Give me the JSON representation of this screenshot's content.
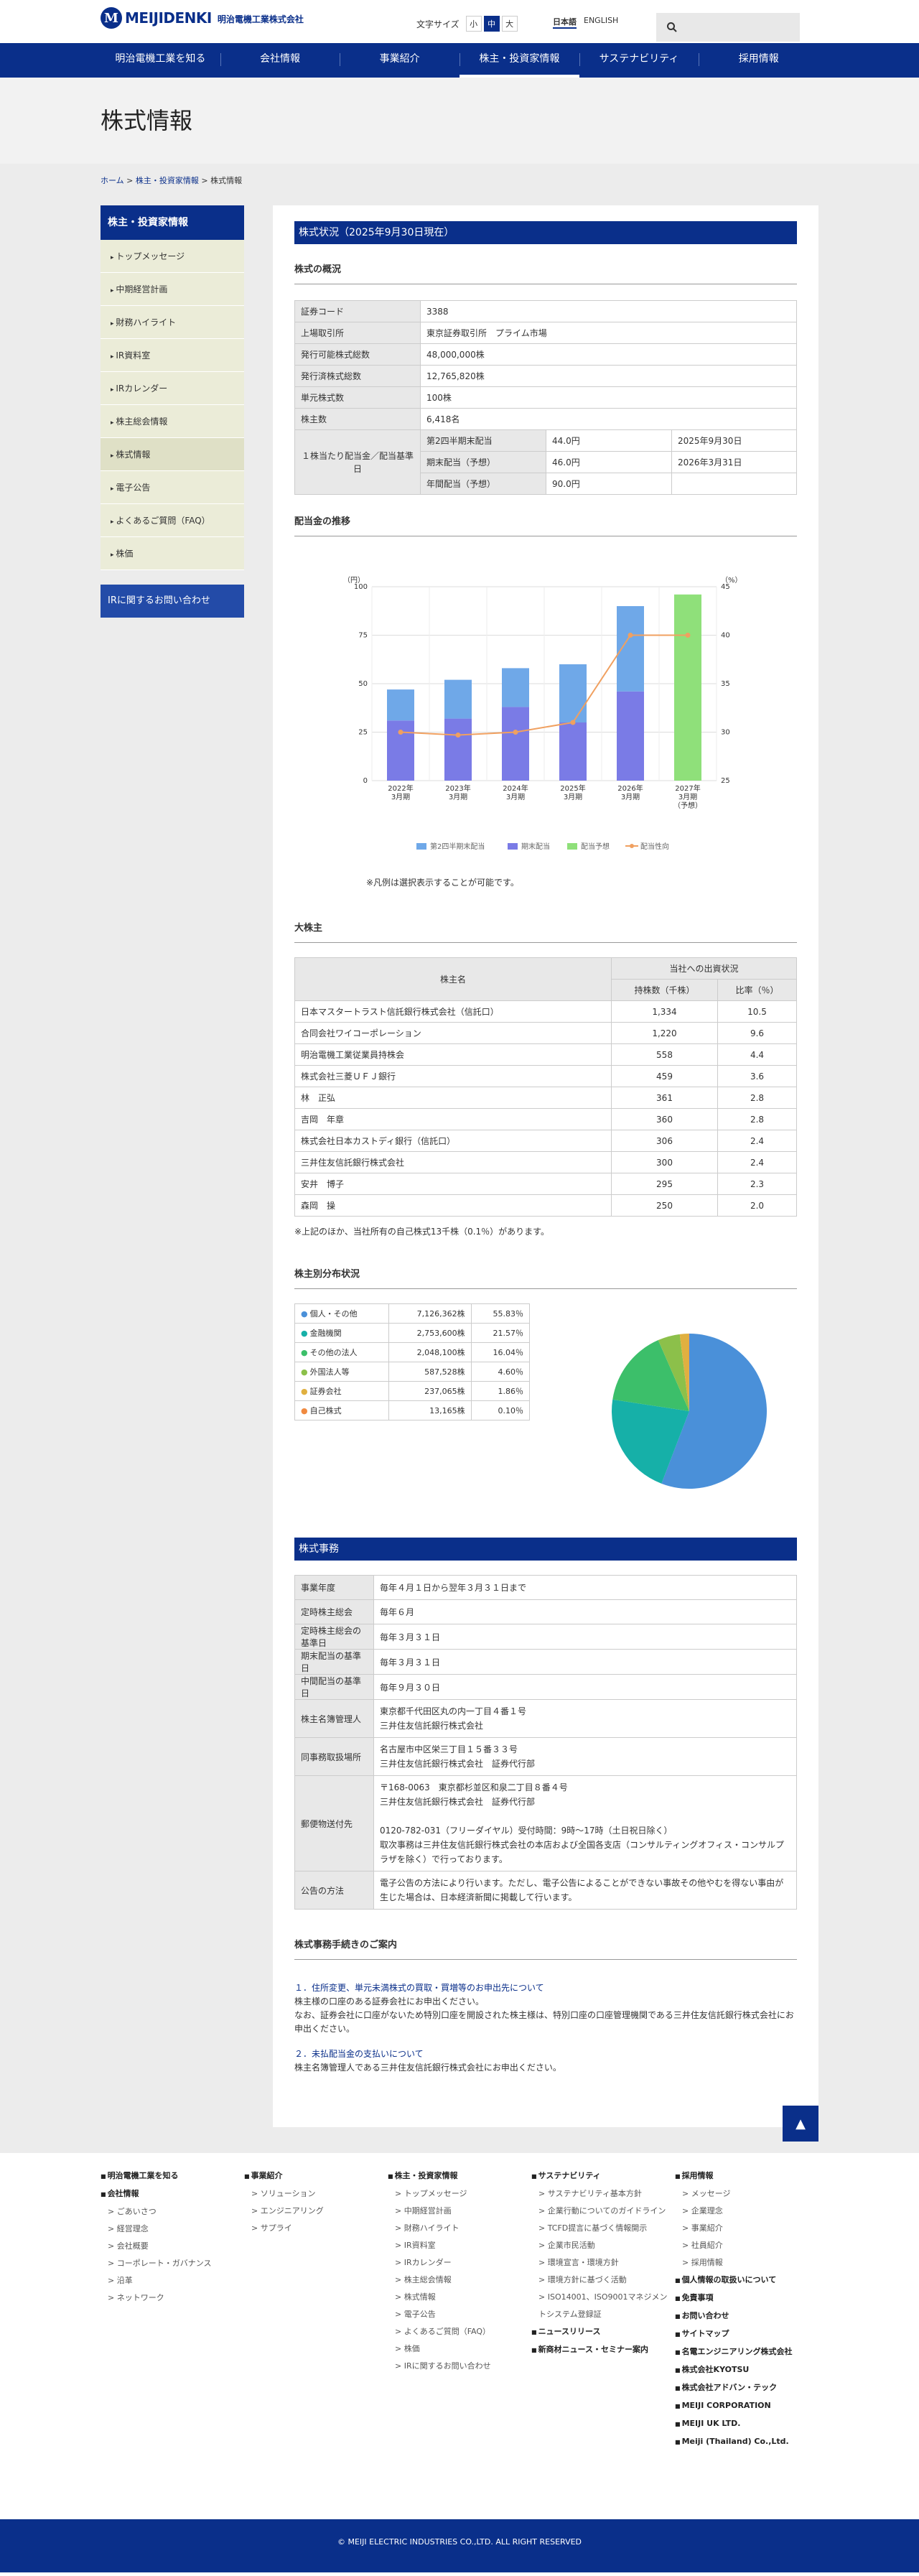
{
  "header": {
    "logo_mark": "M",
    "logo_text": "MEIJIDENKI",
    "logo_sub": "明治電機工業株式会社",
    "fontsize_label": "文字サイズ",
    "fontsize_options": [
      "小",
      "中",
      "大"
    ],
    "lang_ja": "日本語",
    "lang_en": "ENGLISH"
  },
  "gnav": [
    "明治電機工業を知る",
    "会社情報",
    "事業紹介",
    "株主・投資家情報",
    "サステナビリティ",
    "採用情報"
  ],
  "page_title": "株式情報",
  "breadcrumb": {
    "home": "ホーム",
    "parent": "株主・投資家情報",
    "current": "株式情報",
    "sep": " > "
  },
  "sidebar": {
    "title": "株主・投資家情報",
    "items": [
      "トップメッセージ",
      "中期経営計画",
      "財務ハイライト",
      "IR資料室",
      "IRカレンダー",
      "株主総会情報",
      "株式情報",
      "電子公告",
      "よくあるご質問（FAQ）",
      "株価"
    ],
    "contact": "IRに関するお問い合わせ"
  },
  "status": {
    "title": "株式状況（2025年9月30日現在）",
    "overview_title": "株式の概況",
    "rows": [
      {
        "k": "証券コード",
        "v": "3388"
      },
      {
        "k": "上場取引所",
        "v": "東京証券取引所　プライム市場"
      },
      {
        "k": "発行可能株式総数",
        "v": "48,000,000株"
      },
      {
        "k": "発行済株式総数",
        "v": "12,765,820株"
      },
      {
        "k": "単元株式数",
        "v": "100株"
      },
      {
        "k": "株主数",
        "v": "6,418名"
      }
    ],
    "dividend_key": "１株当たり配当金／配当基準日",
    "dividend_rows": [
      {
        "k": "第2四半期末配当",
        "v": "44.0円",
        "d": "2025年9月30日"
      },
      {
        "k": "期末配当（予想）",
        "v": "46.0円",
        "d": "2026年3月31日"
      },
      {
        "k": "年間配当（予想）",
        "v": "90.0円",
        "d": ""
      }
    ]
  },
  "dividend_chart_title": "配当金の推移",
  "chart_note": "※凡例は選択表示することが可能です。",
  "chart_data": {
    "type": "bar",
    "categories": [
      [
        "2022年",
        "3月期"
      ],
      [
        "2023年",
        "3月期"
      ],
      [
        "2024年",
        "3月期"
      ],
      [
        "2025年",
        "3月期"
      ],
      [
        "2026年",
        "3月期"
      ],
      [
        "2027年",
        "3月期",
        "（予想）"
      ]
    ],
    "series": [
      {
        "name": "第2四半期末配当",
        "color": "#6fa8e8",
        "values": [
          16,
          20,
          20,
          30,
          44,
          0
        ]
      },
      {
        "name": "期末配当",
        "color": "#7a7be6",
        "values": [
          31,
          32,
          38,
          30,
          46,
          0
        ]
      },
      {
        "name": "配当予想",
        "color": "#8fe07a",
        "values": [
          0,
          0,
          0,
          0,
          0,
          96
        ]
      },
      {
        "name": "配当性向",
        "color": "#f0a060",
        "values": [
          30,
          29.7,
          30,
          31,
          40,
          40
        ],
        "axis": "right"
      }
    ],
    "ylim": [
      0,
      100
    ],
    "y2lim": [
      25,
      45
    ],
    "yticks": [
      0,
      25,
      50,
      75,
      100
    ],
    "y2ticks": [
      25,
      30,
      35,
      40,
      45
    ],
    "ylabel": "（円）",
    "y2label": "（%）"
  },
  "holders": {
    "title": "大株主",
    "col_name": "株主名",
    "col_group": "当社への出資状況",
    "col_shares": "持株数（千株）",
    "col_ratio": "比率（％）",
    "rows": [
      {
        "n": "日本マスタートラスト信託銀行株式会社（信託口）",
        "s": "1,334",
        "r": "10.5"
      },
      {
        "n": "合同会社ワイコーポレーション",
        "s": "1,220",
        "r": "9.6"
      },
      {
        "n": "明治電機工業従業員持株会",
        "s": "558",
        "r": "4.4"
      },
      {
        "n": "株式会社三菱ＵＦＪ銀行",
        "s": "459",
        "r": "3.6"
      },
      {
        "n": "林　正弘",
        "s": "361",
        "r": "2.8"
      },
      {
        "n": "吉岡　年章",
        "s": "360",
        "r": "2.8"
      },
      {
        "n": "株式会社日本カストディ銀行（信託口）",
        "s": "306",
        "r": "2.4"
      },
      {
        "n": "三井住友信託銀行株式会社",
        "s": "300",
        "r": "2.4"
      },
      {
        "n": "安井　博子",
        "s": "295",
        "r": "2.3"
      },
      {
        "n": "森岡　操",
        "s": "250",
        "r": "2.0"
      }
    ],
    "note": "※上記のほか、当社所有の自己株式13千株（0.1％）があります。"
  },
  "distribution": {
    "title": "株主別分布状況",
    "rows": [
      {
        "n": "個人・その他",
        "s": "7,126,362株",
        "p": "55.83％",
        "v": 55.83,
        "c": "#4a90d9"
      },
      {
        "n": "金融機関",
        "s": "2,753,600株",
        "p": "21.57％",
        "v": 21.57,
        "c": "#16b0a8"
      },
      {
        "n": "その他の法人",
        "s": "2,048,100株",
        "p": "16.04％",
        "v": 16.04,
        "c": "#3cbf6a"
      },
      {
        "n": "外国法人等",
        "s": "587,528株",
        "p": "4.60％",
        "v": 4.6,
        "c": "#8cc04a"
      },
      {
        "n": "証券会社",
        "s": "237,065株",
        "p": "1.86％",
        "v": 1.86,
        "c": "#e0b040"
      },
      {
        "n": "自己株式",
        "s": "13,165株",
        "p": "0.10％",
        "v": 0.1,
        "c": "#f08a40"
      }
    ]
  },
  "admin": {
    "title": "株式事務",
    "rows": [
      {
        "k": "事業年度",
        "v": [
          "毎年４月１日から翌年３月３１日まで"
        ]
      },
      {
        "k": "定時株主総会",
        "v": [
          "毎年６月"
        ]
      },
      {
        "k": "定時株主総会の基準日",
        "v": [
          "毎年３月３１日"
        ]
      },
      {
        "k": "期末配当の基準日",
        "v": [
          "毎年３月３１日"
        ]
      },
      {
        "k": "中間配当の基準日",
        "v": [
          "毎年９月３０日"
        ]
      },
      {
        "k": "株主名簿管理人",
        "v": [
          "東京都千代田区丸の内一丁目４番１号",
          "三井住友信託銀行株式会社"
        ]
      },
      {
        "k": "同事務取扱場所",
        "v": [
          "名古屋市中区栄三丁目１５番３３号",
          "三井住友信託銀行株式会社　証券代行部"
        ]
      },
      {
        "k": "郵便物送付先",
        "v": [
          "〒168-0063　東京都杉並区和泉二丁目８番４号",
          "三井住友信託銀行株式会社　証券代行部",
          "",
          "0120-782-031（フリーダイヤル）受付時間：9時～17時（土日祝日除く）",
          "取次事務は三井住友信託銀行株式会社の本店および全国各支店（コンサルティングオフィス・コンサルプラザを除く）で行っております。"
        ]
      },
      {
        "k": "公告の方法",
        "v": [
          "電子公告の方法により行います。ただし、電子公告によることができない事故その他やむを得ない事由が生じた場合は、日本経済新聞に掲載して行います。"
        ]
      }
    ]
  },
  "procedures": {
    "title": "株式事務手続きのご案内",
    "p1_head": "１．住所変更、単元未満株式の買取・買増等のお申出先について",
    "p1_lines": [
      "株主様の口座のある証券会社にお申出ください。",
      "なお、証券会社に口座がないため特別口座を開設された株主様は、特別口座の口座管理機関である三井住友信託銀行株式会社にお申出ください。"
    ],
    "p2_head": "２．未払配当金の支払いについて",
    "p2_lines": [
      "株主名簿管理人である三井住友信託銀行株式会社にお申出ください。"
    ]
  },
  "footer": {
    "totop": "▲",
    "cols": [
      [
        {
          "h": "明治電機工業を知る"
        },
        {
          "h": "会社情報"
        },
        {
          "s": "ごあいさつ"
        },
        {
          "s": "経営理念"
        },
        {
          "s": "会社概要"
        },
        {
          "s": "コーポレート・ガバナンス"
        },
        {
          "s": "沿革"
        },
        {
          "s": "ネットワーク"
        }
      ],
      [
        {
          "h": "事業紹介"
        },
        {
          "s": "ソリューション"
        },
        {
          "s": "エンジニアリング"
        },
        {
          "s": "サプライ"
        }
      ],
      [
        {
          "h": "株主・投資家情報"
        },
        {
          "s": "トップメッセージ"
        },
        {
          "s": "中期経営計画"
        },
        {
          "s": "財務ハイライト"
        },
        {
          "s": "IR資料室"
        },
        {
          "s": "IRカレンダー"
        },
        {
          "s": "株主総会情報"
        },
        {
          "s": "株式情報"
        },
        {
          "s": "電子公告"
        },
        {
          "s": "よくあるご質問（FAQ）"
        },
        {
          "s": "株価"
        },
        {
          "s": "IRに関するお問い合わせ"
        }
      ],
      [
        {
          "h": "サステナビリティ"
        },
        {
          "s": "サステナビリティ基本方針"
        },
        {
          "s": "企業行動についてのガイドライン"
        },
        {
          "s": "TCFD提言に基づく情報開示"
        },
        {
          "s": "企業市民活動"
        },
        {
          "s": "環境宣言・環境方針"
        },
        {
          "s": "環境方針に基づく活動"
        },
        {
          "s": "ISO14001、ISO9001マネジメントシステム登録証"
        },
        {
          "h": "ニュースリリース"
        },
        {
          "h": "新商材ニュース・セミナー案内"
        }
      ],
      [
        {
          "h": "採用情報"
        },
        {
          "s": "メッセージ"
        },
        {
          "s": "企業理念"
        },
        {
          "s": "事業紹介"
        },
        {
          "s": "社員紹介"
        },
        {
          "s": "採用情報"
        },
        {
          "h": "個人情報の取扱いについて"
        },
        {
          "h": "免責事項"
        },
        {
          "h": "お問い合わせ"
        },
        {
          "h": "サイトマップ"
        },
        {
          "h": "名電エンジニアリング株式会社"
        },
        {
          "h": "株式会社KYOTSU"
        },
        {
          "h": "株式会社アドバン・テック"
        },
        {
          "h": "MEIJI CORPORATION"
        },
        {
          "h": "MEIJI UK LTD."
        },
        {
          "h": "Meiji (Thailand) Co.,Ltd."
        }
      ]
    ],
    "copyright": "© MEIJI ELECTRIC INDUSTRIES CO.,LTD. ALL RIGHT RESERVED"
  }
}
